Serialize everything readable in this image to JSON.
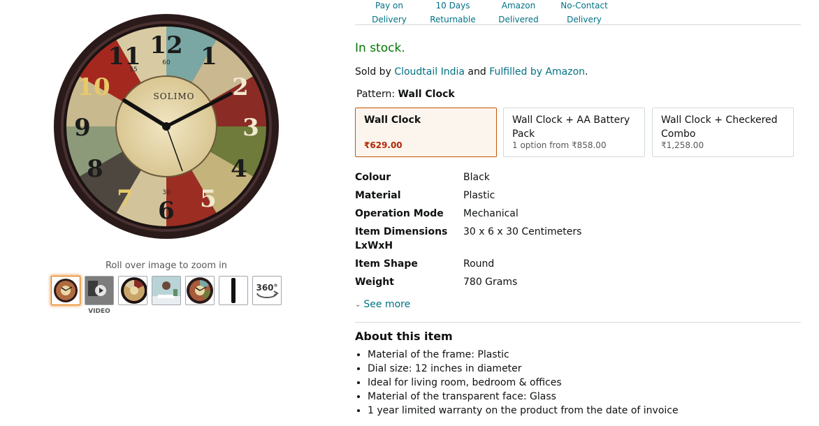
{
  "delivery_features": [
    {
      "line1": "Pay on Delivery",
      "line2": ""
    },
    {
      "line1": "10 Days",
      "line2": "Returnable"
    },
    {
      "line1": "Amazon",
      "line2": "Delivered"
    },
    {
      "line1": "No-Contact",
      "line2": "Delivery"
    }
  ],
  "availability": "In stock.",
  "seller": {
    "prefix": "Sold by",
    "seller_name": "Cloudtail India",
    "middle": "and",
    "fulfilled": "Fulfilled by Amazon",
    "suffix": "."
  },
  "pattern": {
    "label": "Pattern:",
    "value": "Wall Clock"
  },
  "variants": [
    {
      "name": "Wall Clock",
      "price": "₹629.00"
    },
    {
      "name": "Wall Clock + AA Battery Pack",
      "price": "1 option from ₹858.00"
    },
    {
      "name": "Wall Clock + Checkered Combo",
      "price": "₹1,258.00"
    }
  ],
  "specs": [
    {
      "key": "Colour",
      "value": "Black"
    },
    {
      "key": "Material",
      "value": "Plastic"
    },
    {
      "key": "Operation Mode",
      "value": "Mechanical"
    },
    {
      "key": "Item Dimensions LxWxH",
      "value": "30 x 6 x 30 Centimeters"
    },
    {
      "key": "Item Shape",
      "value": "Round"
    },
    {
      "key": "Weight",
      "value": "780 Grams"
    }
  ],
  "see_more": "See more",
  "about": {
    "title": "About this item",
    "bullets": [
      "Material of the frame: Plastic",
      "Dial size: 12 inches in diameter",
      "Ideal for living room, bedroom & offices",
      "Material of the transparent face: Glass",
      "1 year limited warranty on the product from the date of invoice"
    ]
  },
  "gallery": {
    "zoom_hint": "Roll over image to zoom in",
    "video_label": "VIDEO",
    "brand_on_dial": "SOLIMO",
    "rotate_label": "360°",
    "dial_numbers": [
      "12",
      "1",
      "2",
      "3",
      "4",
      "5",
      "6",
      "7",
      "8",
      "9",
      "10",
      "11"
    ],
    "minute_marks": [
      "60",
      "55",
      "30"
    ]
  },
  "colors": {
    "link": "#007185",
    "in_stock": "#007600",
    "price_red": "#b12704",
    "selected_border": "#c45500",
    "selected_bg": "#fcf5ee"
  }
}
